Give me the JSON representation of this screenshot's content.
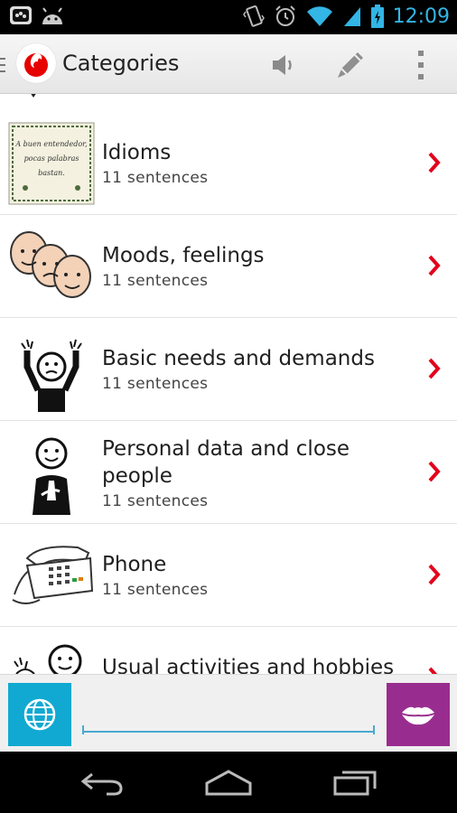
{
  "status_bar": {
    "time": "12:09",
    "icons": [
      "bbm-icon",
      "android-icon",
      "vibrate-icon",
      "alarm-icon",
      "wifi-icon",
      "signal-icon",
      "battery-icon"
    ]
  },
  "action_bar": {
    "title": "Categories",
    "actions": [
      "speaker-icon",
      "pencil-icon",
      "overflow-menu-icon"
    ]
  },
  "categories": [
    {
      "title": "Idioms",
      "subtitle": "11 sentences",
      "icon": "idioms-card-icon"
    },
    {
      "title": "Moods, feelings",
      "subtitle": "11 sentences",
      "icon": "faces-icon"
    },
    {
      "title": "Basic needs and demands",
      "subtitle": "11 sentences",
      "icon": "needs-person-icon"
    },
    {
      "title": "Personal data and close people",
      "subtitle": "11 sentences",
      "icon": "person-icon"
    },
    {
      "title": "Phone",
      "subtitle": "11 sentences",
      "icon": "telephone-icon"
    },
    {
      "title": "Usual activities and hobbies",
      "subtitle": "",
      "icon": "activities-icon"
    }
  ],
  "idioms_card_text": "A buen entendedor, pocas palabras bastan.",
  "input": {
    "value": "",
    "placeholder": ""
  },
  "colors": {
    "accent_blue": "#11a9d2",
    "speak_purple": "#992d8f",
    "chevron_red": "#e3001b",
    "time_blue": "#33b5e5"
  }
}
